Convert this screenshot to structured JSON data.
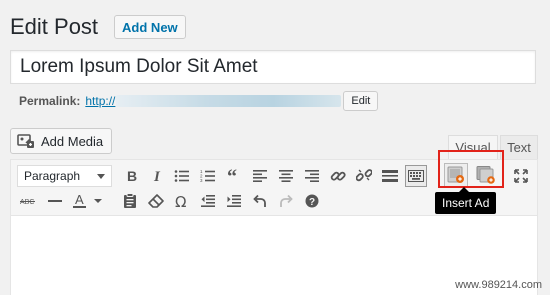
{
  "header": {
    "title": "Edit Post",
    "add_new_label": "Add New"
  },
  "post": {
    "title_value": "Lorem Ipsum Dolor Sit Amet",
    "permalink_label": "Permalink:",
    "permalink_url": "http://",
    "permalink_edit_label": "Edit"
  },
  "media": {
    "add_media_label": "Add Media"
  },
  "editor_tabs": {
    "visual": "Visual",
    "text": "Text"
  },
  "toolbar": {
    "format_value": "Paragraph",
    "tooltip": "Insert Ad",
    "highlight_color": "#e2231a"
  },
  "footer": {
    "watermark": "www.989214.com"
  }
}
